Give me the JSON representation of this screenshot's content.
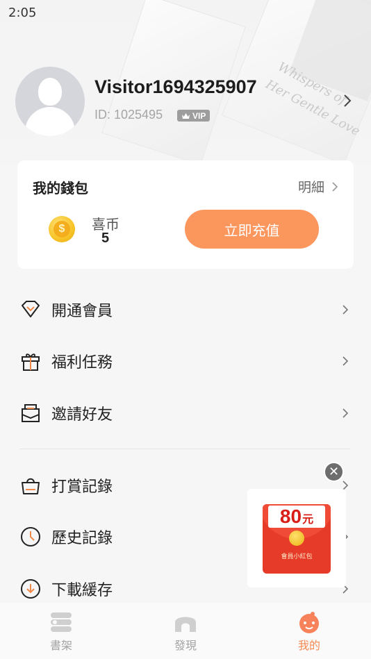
{
  "status_bar": {
    "time": "2:05"
  },
  "profile": {
    "username": "Visitor1694325907",
    "id_text": "ID: 1025495",
    "vip_badge": "VIP"
  },
  "wallet": {
    "title": "我的錢包",
    "detail_label": "明細",
    "coin_label": "喜币",
    "coin_value": "5",
    "recharge_label": "立即充值"
  },
  "menu": [
    {
      "label": "開通會員",
      "icon": "diamond-icon"
    },
    {
      "label": "福利任務",
      "icon": "gift-icon"
    },
    {
      "label": "邀請好友",
      "icon": "envelope-icon"
    },
    {
      "label": "打賞記錄",
      "icon": "bag-icon"
    },
    {
      "label": "歷史記錄",
      "icon": "clock-icon"
    },
    {
      "label": "下載緩存",
      "icon": "download-icon"
    }
  ],
  "popup": {
    "amount": "80",
    "unit": "元",
    "caption": "會員小紅包"
  },
  "tabs": [
    {
      "label": "書架",
      "icon": "bookshelf-icon"
    },
    {
      "label": "發現",
      "icon": "discover-icon"
    },
    {
      "label": "我的",
      "icon": "profile-face-icon",
      "active": true
    }
  ],
  "colors": {
    "accent": "#fb965d",
    "active_tab": "#f68a55",
    "envelope_red": "#e73b2a"
  }
}
